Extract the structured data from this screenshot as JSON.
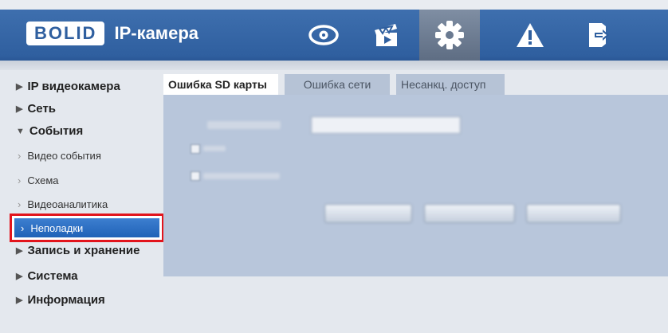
{
  "header": {
    "brand": "BOLID",
    "title": "IP-камера",
    "nav": [
      {
        "icon": "eye-icon"
      },
      {
        "icon": "clapperboard-icon"
      },
      {
        "icon": "gear-icon",
        "active": true
      },
      {
        "icon": "warning-icon"
      },
      {
        "icon": "logout-icon"
      }
    ]
  },
  "sidebar": {
    "items": [
      {
        "label": "IP видеокамера"
      },
      {
        "label": "Сеть"
      },
      {
        "label": "События"
      },
      {
        "label": "Запись и хранение"
      },
      {
        "label": "Система"
      },
      {
        "label": "Информация"
      }
    ],
    "sub_items": [
      {
        "label": "Видео события"
      },
      {
        "label": "Схема"
      },
      {
        "label": "Видеоаналитика"
      },
      {
        "label": "Неполадки"
      }
    ]
  },
  "tabs": [
    {
      "label": "Ошибка SD карты"
    },
    {
      "label": "Ошибка сети"
    },
    {
      "label": "Несанкц. доступ"
    }
  ],
  "colors": {
    "accent": "#2f5f9f",
    "highlight_border": "#e2141c",
    "selected_item": "#2062b7"
  }
}
